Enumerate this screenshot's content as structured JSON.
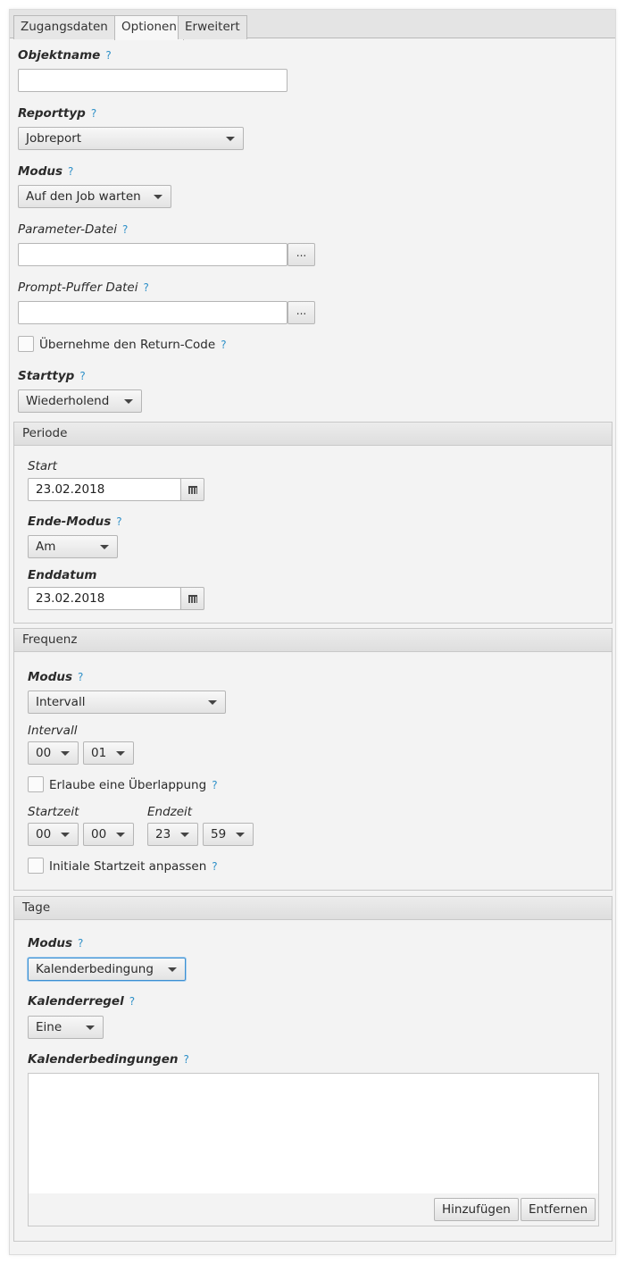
{
  "tabs": [
    {
      "label": "Zugangsdaten",
      "active": false
    },
    {
      "label": "Optionen",
      "active": true
    },
    {
      "label": "Erweitert",
      "active": false
    }
  ],
  "help_glyph": "?",
  "object_name": {
    "label": "Objektname",
    "value": ""
  },
  "report_type": {
    "label": "Reporttyp",
    "value": "Jobreport"
  },
  "mode": {
    "label": "Modus",
    "value": "Auf den Job warten"
  },
  "param_file": {
    "label": "Parameter-Datei",
    "value": "",
    "browse_label": "..."
  },
  "prompt_file": {
    "label": "Prompt-Puffer Datei",
    "value": "",
    "browse_label": "..."
  },
  "return_code": {
    "label": "Übernehme den Return-Code",
    "checked": false
  },
  "start_type": {
    "label": "Starttyp",
    "value": "Wiederholend"
  },
  "period": {
    "title": "Periode",
    "start_label": "Start",
    "start_value": "23.02.2018",
    "end_mode_label": "Ende-Modus",
    "end_mode_value": "Am",
    "end_date_label": "Enddatum",
    "end_date_value": "23.02.2018"
  },
  "frequency": {
    "title": "Frequenz",
    "mode_label": "Modus",
    "mode_value": "Intervall",
    "interval_label": "Intervall",
    "interval_hours": "00",
    "interval_minutes": "01",
    "overlap_label": "Erlaube eine Überlappung",
    "overlap_checked": false,
    "start_time_label": "Startzeit",
    "start_hours": "00",
    "start_minutes": "00",
    "end_time_label": "Endzeit",
    "end_hours": "23",
    "end_minutes": "59",
    "adjust_label": "Initiale Startzeit anpassen",
    "adjust_checked": false
  },
  "days": {
    "title": "Tage",
    "mode_label": "Modus",
    "mode_value": "Kalenderbedingung",
    "rule_label": "Kalenderregel",
    "rule_value": "Eine",
    "conditions_label": "Kalenderbedingungen",
    "conditions": [],
    "add_label": "Hinzufügen",
    "remove_label": "Entfernen"
  },
  "colors": {
    "help": "#2e90c8",
    "focus": "#3b8fd1",
    "background": "#f3f3f3"
  }
}
